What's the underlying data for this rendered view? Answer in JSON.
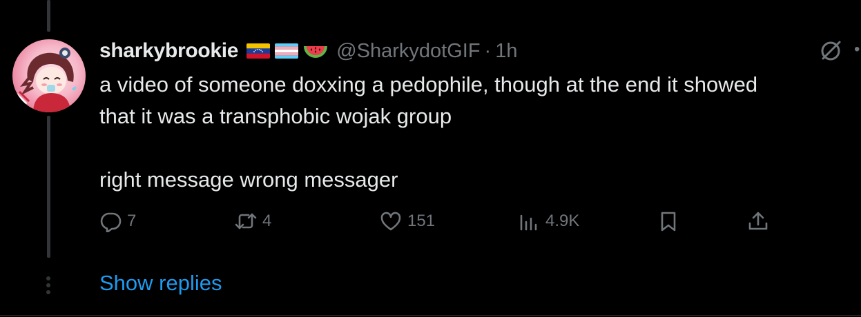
{
  "tweet": {
    "display_name": "sharkybrookie",
    "flags": [
      "venezuela-flag",
      "transgender-flag",
      "watermelon"
    ],
    "handle": "@SharkydotGIF",
    "separator": "·",
    "time": "1h",
    "text_line1": "a video of someone doxxing a pedophile, though at the end it showed",
    "text_line2": "that it was a transphobic wojak group",
    "text_line3": "right message wrong messager"
  },
  "actions": {
    "replies": "7",
    "reposts": "4",
    "likes": "151",
    "views": "4.9K"
  },
  "show_replies_label": "Show replies",
  "colors": {
    "background": "#000000",
    "text": "#e7e9ea",
    "muted": "#71767b",
    "accent": "#1d9bf0",
    "thread_line": "#333639"
  },
  "icons": {
    "reply": "reply-icon",
    "repost": "repost-icon",
    "like": "heart-icon",
    "views": "views-icon",
    "bookmark": "bookmark-icon",
    "share": "share-icon",
    "grok": "grok-icon",
    "more": "more-icon"
  }
}
